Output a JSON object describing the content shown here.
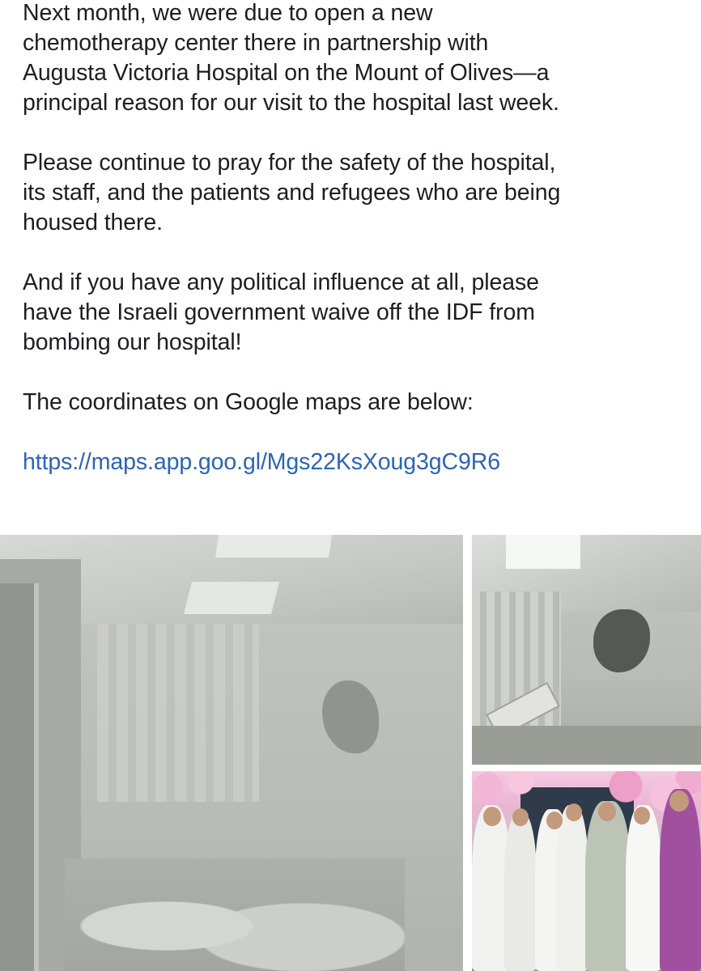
{
  "post": {
    "paragraphs": [
      "Next month, we were due to open a new\nchemotherapy center there in partnership with\nAugusta Victoria Hospital on the Mount of Olives—a\nprincipal reason for our visit to the hospital last week.",
      "Please continue to pray for the safety of the hospital,\nits staff, and the patients and refugees who are being\nhoused there.",
      "And if you have any political influence at all, please\nhave the Israeli government waive off the IDF from\nbombing our hospital!",
      "The coordinates on Google maps are below:"
    ],
    "link": "https://maps.app.goo.gl/Mgs22KsXoug3gC9R6"
  },
  "colors": {
    "text": "#1c1e21",
    "link": "#2d63b7",
    "background": "#ffffff"
  }
}
